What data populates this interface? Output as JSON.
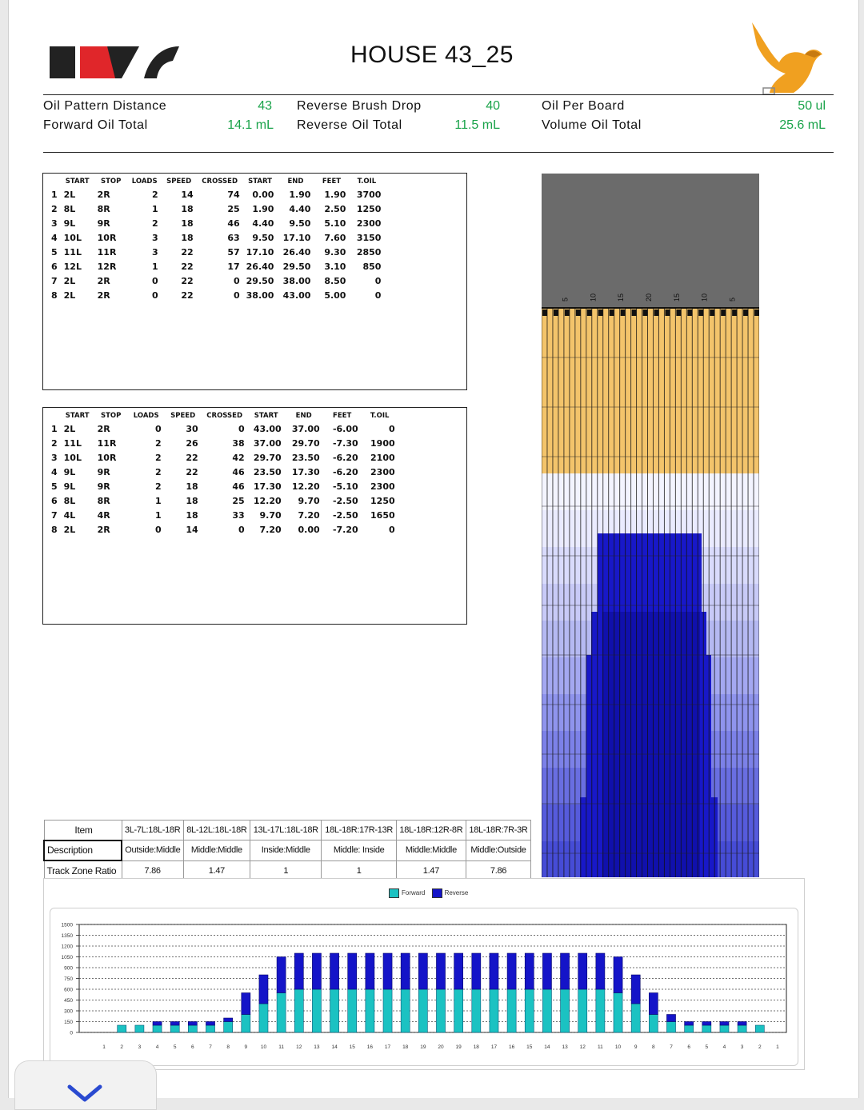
{
  "title": "HOUSE 43_25",
  "summary": {
    "pattern_distance_label": "Oil Pattern Distance",
    "pattern_distance": "43",
    "forward_total_label": "Forward Oil Total",
    "forward_total": "14.1 mL",
    "brush_drop_label": "Reverse Brush Drop",
    "brush_drop": "40",
    "reverse_total_label": "Reverse Oil Total",
    "reverse_total": "11.5 mL",
    "per_board_label": "Oil Per Board",
    "per_board": "50 ul",
    "volume_total_label": "Volume Oil Total",
    "volume_total": "25.6 mL"
  },
  "forward_table": {
    "headers": [
      "",
      "START",
      "STOP",
      "LOADS",
      "SPEED",
      "CROSSED",
      "START",
      "END",
      "FEET",
      "T.OIL"
    ],
    "rows": [
      [
        "1",
        "2L",
        "2R",
        "2",
        "14",
        "74",
        "0.00",
        "1.90",
        "1.90",
        "3700"
      ],
      [
        "2",
        "8L",
        "8R",
        "1",
        "18",
        "25",
        "1.90",
        "4.40",
        "2.50",
        "1250"
      ],
      [
        "3",
        "9L",
        "9R",
        "2",
        "18",
        "46",
        "4.40",
        "9.50",
        "5.10",
        "2300"
      ],
      [
        "4",
        "10L",
        "10R",
        "3",
        "18",
        "63",
        "9.50",
        "17.10",
        "7.60",
        "3150"
      ],
      [
        "5",
        "11L",
        "11R",
        "3",
        "22",
        "57",
        "17.10",
        "26.40",
        "9.30",
        "2850"
      ],
      [
        "6",
        "12L",
        "12R",
        "1",
        "22",
        "17",
        "26.40",
        "29.50",
        "3.10",
        "850"
      ],
      [
        "7",
        "2L",
        "2R",
        "0",
        "22",
        "0",
        "29.50",
        "38.00",
        "8.50",
        "0"
      ],
      [
        "8",
        "2L",
        "2R",
        "0",
        "22",
        "0",
        "38.00",
        "43.00",
        "5.00",
        "0"
      ]
    ]
  },
  "reverse_table": {
    "headers": [
      "",
      "START",
      "STOP",
      "LOADS",
      "SPEED",
      "CROSSED",
      "START",
      "END",
      "FEET",
      "T.OIL"
    ],
    "rows": [
      [
        "1",
        "2L",
        "2R",
        "0",
        "30",
        "0",
        "43.00",
        "37.00",
        "-6.00",
        "0"
      ],
      [
        "2",
        "11L",
        "11R",
        "2",
        "26",
        "38",
        "37.00",
        "29.70",
        "-7.30",
        "1900"
      ],
      [
        "3",
        "10L",
        "10R",
        "2",
        "22",
        "42",
        "29.70",
        "23.50",
        "-6.20",
        "2100"
      ],
      [
        "4",
        "9L",
        "9R",
        "2",
        "22",
        "46",
        "23.50",
        "17.30",
        "-6.20",
        "2300"
      ],
      [
        "5",
        "9L",
        "9R",
        "2",
        "18",
        "46",
        "17.30",
        "12.20",
        "-5.10",
        "2300"
      ],
      [
        "6",
        "8L",
        "8R",
        "1",
        "18",
        "25",
        "12.20",
        "9.70",
        "-2.50",
        "1250"
      ],
      [
        "7",
        "4L",
        "4R",
        "1",
        "18",
        "33",
        "9.70",
        "7.20",
        "-2.50",
        "1650"
      ],
      [
        "8",
        "2L",
        "2R",
        "0",
        "14",
        "0",
        "7.20",
        "0.00",
        "-7.20",
        "0"
      ]
    ]
  },
  "lane": {
    "arrow_labels": [
      "5",
      "10",
      "15",
      "20",
      "15",
      "10",
      "5"
    ],
    "colors": {
      "pin_deck": "#6b6b6b",
      "dry": "#f3c46b",
      "forward": "#dfe0fb",
      "reverse": "#1818c8"
    }
  },
  "ratio_table": {
    "header_label": "Item",
    "columns": [
      "3L-7L:18L-18R",
      "8L-12L:18L-18R",
      "13L-17L:18L-18R",
      "18L-18R:17R-13R",
      "18L-18R:12R-8R",
      "18L-18R:7R-3R"
    ],
    "description_label": "Description",
    "descriptions": [
      "Outside:Middle",
      "Middle:Middle",
      "Inside:Middle",
      "Middle: Inside",
      "Middle:Middle",
      "Middle:Outside"
    ],
    "ratio_label": "Track Zone Ratio",
    "ratios": [
      "7.86",
      "1.47",
      "1",
      "1",
      "1.47",
      "7.86"
    ]
  },
  "chart_data": {
    "type": "bar",
    "stacked": true,
    "legend": [
      "Forward",
      "Reverse"
    ],
    "colors": {
      "Forward": "#1bc2c2",
      "Reverse": "#1414c8"
    },
    "y_ticks": [
      "1500",
      "1350",
      "1200",
      "1050",
      "900",
      "750",
      "600",
      "450",
      "300",
      "150",
      "0"
    ],
    "ylim": [
      0,
      1500
    ],
    "categories": [
      "1",
      "2",
      "3",
      "4",
      "5",
      "6",
      "7",
      "8",
      "9",
      "10",
      "11",
      "12",
      "13",
      "14",
      "15",
      "16",
      "17",
      "18",
      "19",
      "20",
      "19",
      "18",
      "17",
      "16",
      "15",
      "14",
      "13",
      "12",
      "11",
      "10",
      "9",
      "8",
      "7",
      "6",
      "5",
      "4",
      "3",
      "2",
      "1"
    ],
    "series": [
      {
        "name": "Forward",
        "values": [
          0,
          100,
          100,
          100,
          100,
          100,
          100,
          150,
          250,
          400,
          550,
          600,
          600,
          600,
          600,
          600,
          600,
          600,
          600,
          600,
          600,
          600,
          600,
          600,
          600,
          600,
          600,
          600,
          600,
          550,
          400,
          250,
          150,
          100,
          100,
          100,
          100,
          100,
          0
        ]
      },
      {
        "name": "Reverse",
        "values": [
          0,
          0,
          0,
          50,
          50,
          50,
          50,
          50,
          300,
          400,
          500,
          500,
          500,
          500,
          500,
          500,
          500,
          500,
          500,
          500,
          500,
          500,
          500,
          500,
          500,
          500,
          500,
          500,
          500,
          500,
          400,
          300,
          100,
          50,
          50,
          50,
          50,
          0,
          0
        ]
      }
    ]
  }
}
